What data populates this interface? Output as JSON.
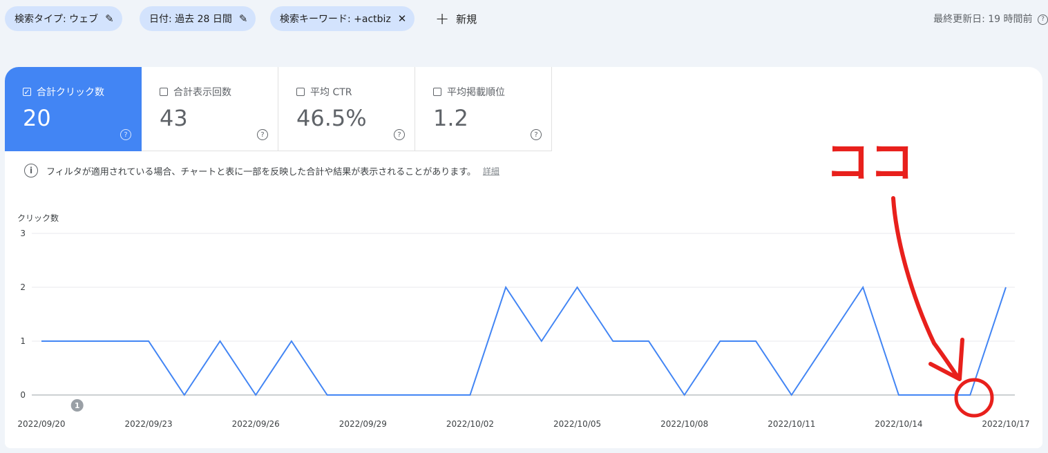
{
  "filters": [
    {
      "label": "検索タイプ: ウェブ",
      "icon": "pencil-icon"
    },
    {
      "label": "日付: 過去 28 日間",
      "icon": "pencil-icon"
    },
    {
      "label": "検索キーワード: +actbiz",
      "icon": "close-icon"
    }
  ],
  "new_button": {
    "plus": "+",
    "label": "新規"
  },
  "last_updated": "最終更新日: 19 時間前",
  "metrics": [
    {
      "label": "合計クリック数",
      "value": "20",
      "checked": true
    },
    {
      "label": "合計表示回数",
      "value": "43",
      "checked": false
    },
    {
      "label": "平均 CTR",
      "value": "46.5%",
      "checked": false
    },
    {
      "label": "平均掲載順位",
      "value": "1.2",
      "checked": false
    }
  ],
  "notice": {
    "text": "フィルタが適用されている場合、チャートと表に一部を反映した合計や結果が表示されることがあります。",
    "link": "詳細"
  },
  "annotation": {
    "text": "ココ",
    "color": "#e8201c"
  },
  "chart_data": {
    "type": "line",
    "ylabel": "クリック数",
    "ylim": [
      0,
      3
    ],
    "yticks": [
      0,
      1,
      2,
      3
    ],
    "grid": true,
    "color": "#4285f4",
    "x": [
      "2022/09/20",
      "2022/09/21",
      "2022/09/22",
      "2022/09/23",
      "2022/09/24",
      "2022/09/25",
      "2022/09/26",
      "2022/09/27",
      "2022/09/28",
      "2022/09/29",
      "2022/09/30",
      "2022/10/01",
      "2022/10/02",
      "2022/10/03",
      "2022/10/04",
      "2022/10/05",
      "2022/10/06",
      "2022/10/07",
      "2022/10/08",
      "2022/10/09",
      "2022/10/10",
      "2022/10/11",
      "2022/10/12",
      "2022/10/13",
      "2022/10/14",
      "2022/10/15",
      "2022/10/16",
      "2022/10/17"
    ],
    "xtick_labels": [
      "2022/09/20",
      "2022/09/23",
      "2022/09/26",
      "2022/09/29",
      "2022/10/02",
      "2022/10/05",
      "2022/10/08",
      "2022/10/11",
      "2022/10/14",
      "2022/10/17"
    ],
    "series": [
      {
        "values": [
          1,
          1,
          1,
          1,
          0,
          1,
          0,
          1,
          0,
          0,
          0,
          0,
          0,
          2,
          1,
          2,
          1,
          1,
          0,
          1,
          1,
          0,
          1,
          2,
          0,
          0,
          0,
          2
        ]
      }
    ],
    "event_marker": {
      "x": "2022/09/21",
      "label": "1"
    }
  }
}
